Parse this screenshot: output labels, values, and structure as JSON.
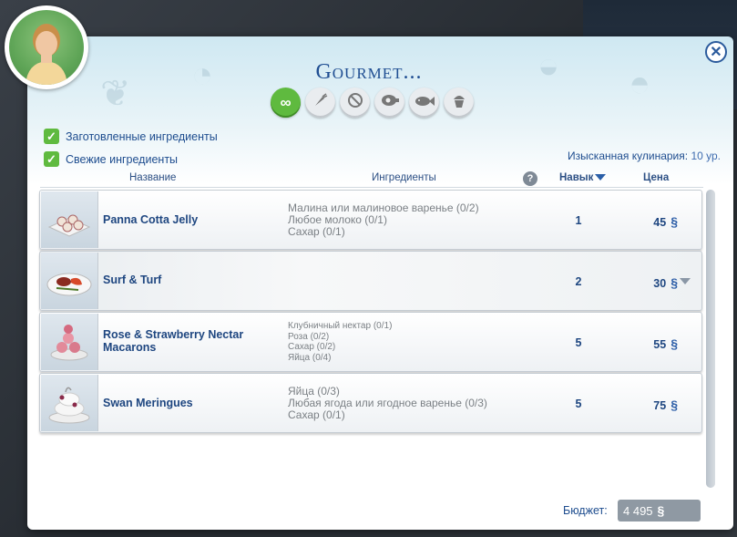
{
  "dialog": {
    "title": "Gourmet...",
    "close_label": "✕"
  },
  "filters": [
    {
      "name": "all",
      "icon": "infinity-icon",
      "glyph": "∞",
      "active": true
    },
    {
      "name": "vegetables",
      "icon": "carrot-icon",
      "glyph": "🥕",
      "active": false
    },
    {
      "name": "no-meat",
      "icon": "no-meat-icon",
      "glyph": "⊘",
      "active": false
    },
    {
      "name": "meat",
      "icon": "meat-icon",
      "glyph": "◐",
      "active": false
    },
    {
      "name": "fish",
      "icon": "fish-icon",
      "glyph": "➤",
      "active": false
    },
    {
      "name": "dessert",
      "icon": "cupcake-icon",
      "glyph": "◓",
      "active": false
    }
  ],
  "options": {
    "prepared_label": "Заготовленные ингредиенты",
    "fresh_label": "Свежие ингредиенты",
    "check_mark": "✓"
  },
  "skill": {
    "label": "Изысканная кулинария:",
    "value": "10 ур."
  },
  "table": {
    "col_name": "Название",
    "col_ingredients": "Ингредиенты",
    "col_help": "?",
    "col_skill": "Навык",
    "col_price": "Цена"
  },
  "recipes": [
    {
      "name": "Panna Cotta Jelly",
      "ingredients": [
        "Малина или малиновое варенье (0/2)",
        "Любое молоко (0/1)",
        "Сахар (0/1)"
      ],
      "skill": "1",
      "price": "45",
      "image_icon": "panna-cotta-icon"
    },
    {
      "name": "Surf & Turf",
      "ingredients": [],
      "skill": "2",
      "price": "30",
      "image_icon": "surf-turf-icon"
    },
    {
      "name": "Rose & Strawberry Nectar Macarons",
      "ingredients": [
        "Клубничный нектар (0/1)",
        "Роза (0/2)",
        "Сахар (0/2)",
        "Яйца (0/4)"
      ],
      "skill": "5",
      "price": "55",
      "image_icon": "macarons-icon"
    },
    {
      "name": "Swan Meringues",
      "ingredients": [
        "Яйца (0/3)",
        "Любая ягода или ягодное варенье (0/3)",
        "Сахар (0/1)"
      ],
      "skill": "5",
      "price": "75",
      "image_icon": "meringues-icon"
    }
  ],
  "currency_symbol": "§",
  "budget": {
    "label": "Бюджет:",
    "value": "4 495"
  },
  "colors": {
    "accent": "#1f4e92",
    "active_filter": "#5fba3f"
  }
}
